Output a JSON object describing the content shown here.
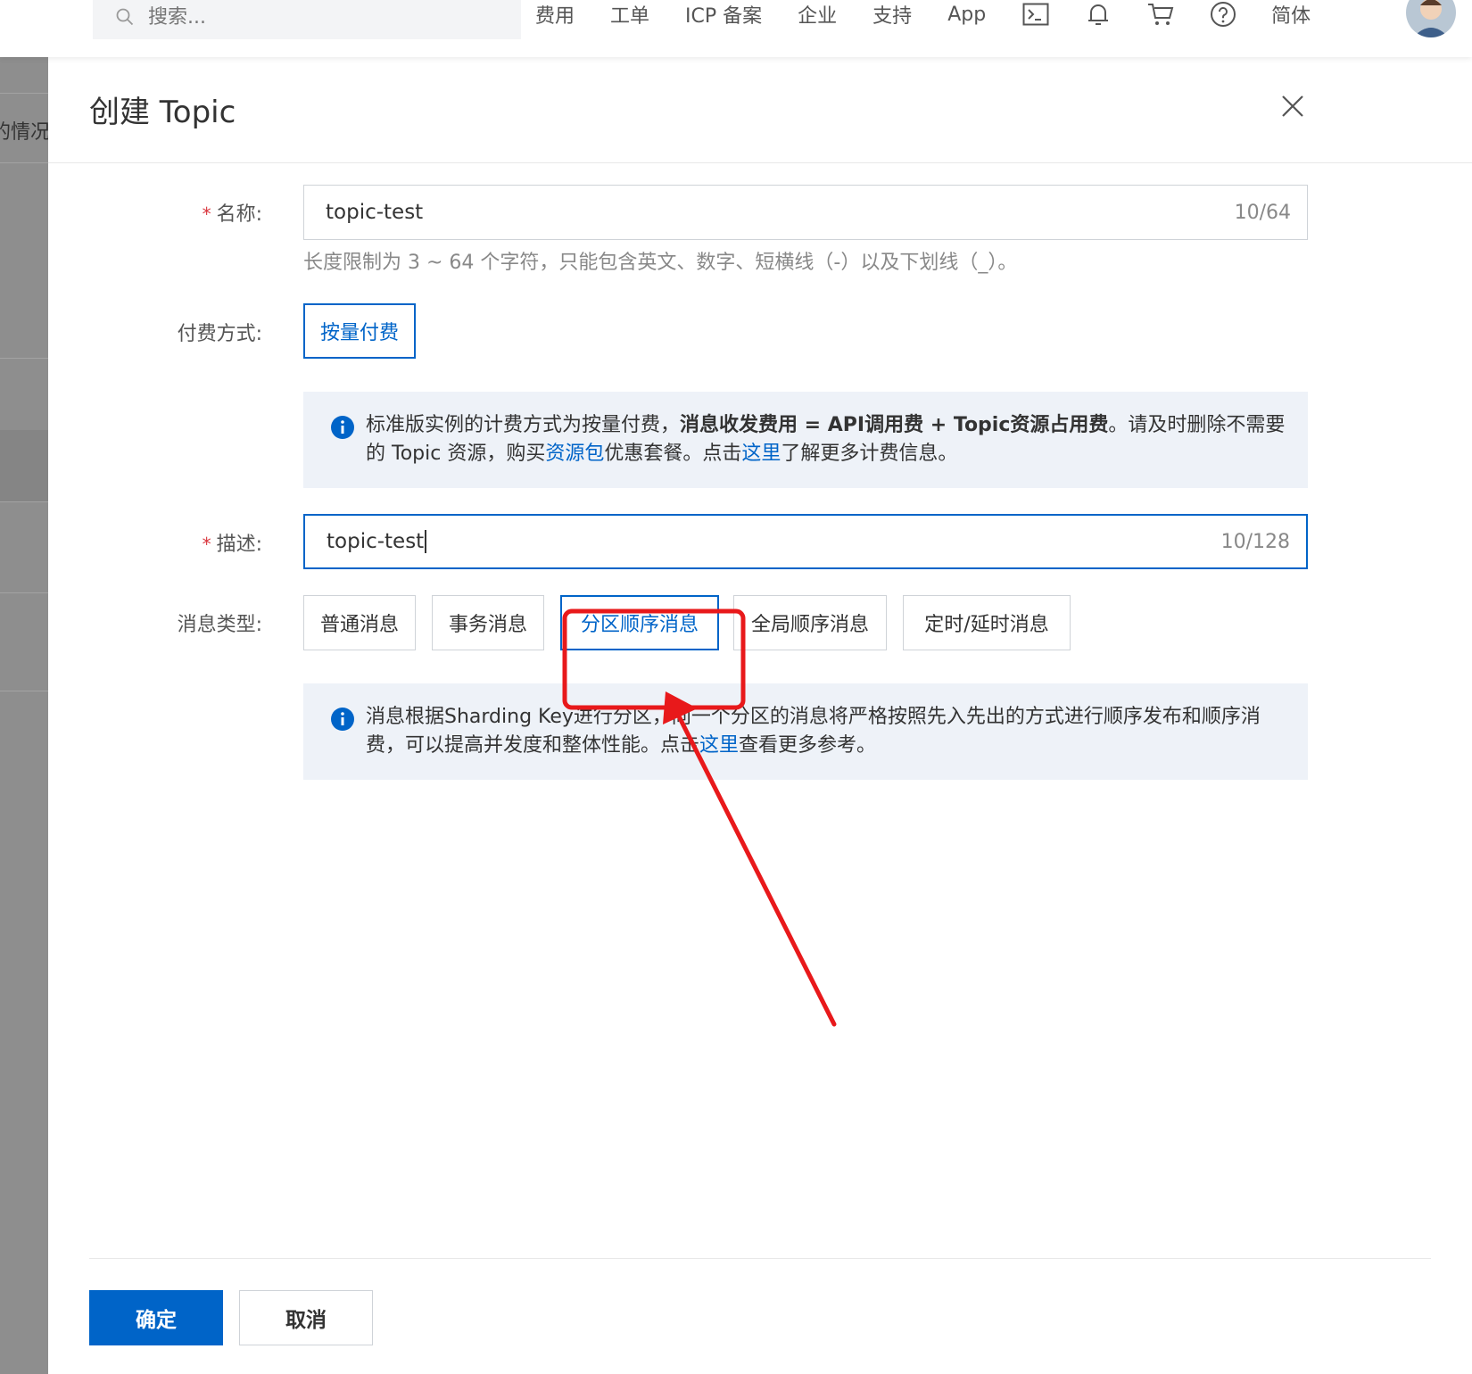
{
  "topbar": {
    "search_placeholder": "搜索...",
    "nav": [
      "费用",
      "工单",
      "ICP 备案",
      "企业",
      "支持",
      "App"
    ],
    "lang": "简体"
  },
  "sidebar": {
    "partial_text": "的情况"
  },
  "dialog": {
    "title": "创建 Topic",
    "name_label": "名称:",
    "name_value": "topic-test",
    "name_count": "10/64",
    "name_hint": "长度限制为 3 ~ 64 个字符，只能包含英文、数字、短横线（-）以及下划线（_）。",
    "billing_label": "付费方式:",
    "billing_option": "按量付费",
    "billing_notice": {
      "t1": "标准版实例的计费方式为按量付费，",
      "t2": "消息收发费用 = API调用费 + Topic资源占用费",
      "t3": "。请及时删除不需要的 Topic 资源，购买",
      "link1": "资源包",
      "t4": "优惠套餐。点击",
      "link2": "这里",
      "t5": "了解更多计费信息。"
    },
    "desc_label": "描述:",
    "desc_value": "topic-test",
    "desc_count": "10/128",
    "type_label": "消息类型:",
    "type_options": [
      "普通消息",
      "事务消息",
      "分区顺序消息",
      "全局顺序消息",
      "定时/延时消息"
    ],
    "type_notice": {
      "t1": "消息根据Sharding Key进行分区，同一个分区的消息将严格按照先入先出的方式进行顺序发布和顺序消费，可以提高并发度和整体性能。点击",
      "link": "这里",
      "t2": "查看更多参考。"
    },
    "ok_label": "确定",
    "cancel_label": "取消"
  },
  "colors": {
    "accent": "#0064c8",
    "annotation": "#e8191b"
  }
}
